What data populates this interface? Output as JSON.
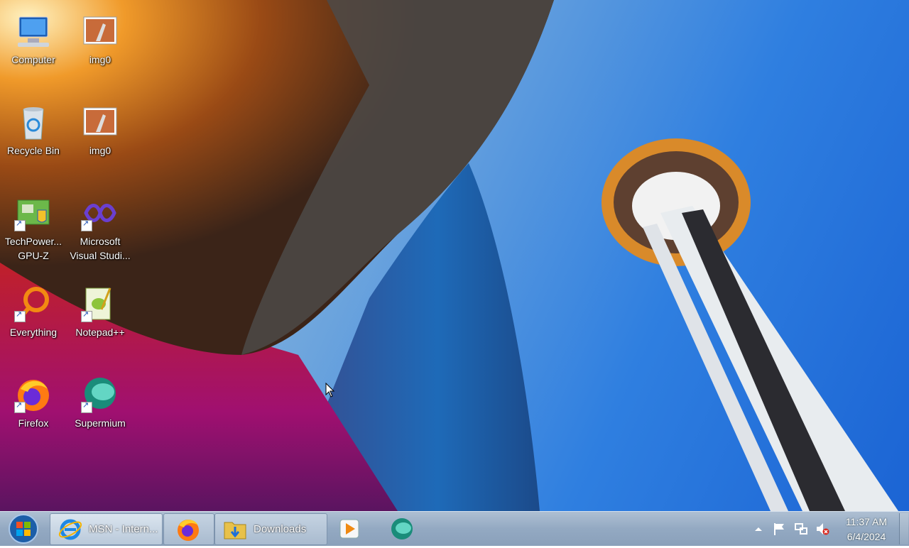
{
  "desktop": {
    "icons": [
      {
        "label": "Computer",
        "icon": "computer-icon"
      },
      {
        "label": "img0",
        "icon": "image-file-icon"
      },
      {
        "label": "Recycle Bin",
        "icon": "recycle-bin-icon"
      },
      {
        "label": "img0",
        "icon": "image-file-icon"
      },
      {
        "label": "TechPower... GPU-Z",
        "icon": "gpu-z-icon"
      },
      {
        "label": "Microsoft Visual Studi...",
        "icon": "visual-studio-icon"
      },
      {
        "label": "Everything",
        "icon": "everything-search-icon"
      },
      {
        "label": "Notepad++",
        "icon": "notepad-plus-plus-icon"
      },
      {
        "label": "Firefox",
        "icon": "firefox-icon"
      },
      {
        "label": "Supermium",
        "icon": "supermium-icon"
      }
    ]
  },
  "taskbar": {
    "start_icon": "windows-start-icon",
    "buttons": [
      {
        "label": "MSN - Intern...",
        "icon": "internet-explorer-icon"
      },
      {
        "label": "",
        "icon": "firefox-icon"
      },
      {
        "label": "Downloads",
        "icon": "folder-downloads-icon"
      },
      {
        "label": "",
        "icon": "media-player-icon"
      },
      {
        "label": "",
        "icon": "supermium-icon"
      }
    ],
    "tray": {
      "icons": [
        "show-hidden-icons-arrow",
        "action-center-flag-icon",
        "network-icon",
        "volume-muted-icon"
      ],
      "time": "11:37 AM",
      "date": "6/4/2024"
    }
  },
  "colors": {
    "sky": "#2f7fe0",
    "taskbar": "#93a9c2"
  }
}
